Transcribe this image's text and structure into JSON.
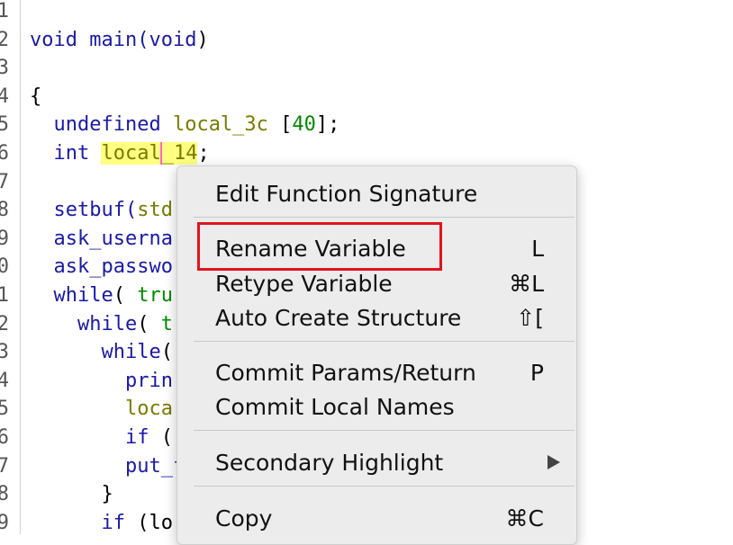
{
  "editor": {
    "lines": [
      {
        "n": "1",
        "tokens": []
      },
      {
        "n": "2",
        "tokens": [
          {
            "t": "void",
            "c": "kw"
          },
          {
            "t": " main(",
            "c": "fn"
          },
          {
            "t": "void",
            "c": "kw"
          },
          {
            "t": ")",
            "c": ""
          }
        ]
      },
      {
        "n": "3",
        "tokens": []
      },
      {
        "n": "4",
        "tokens": [
          {
            "t": "{",
            "c": ""
          }
        ]
      },
      {
        "n": "5",
        "tokens": [
          {
            "t": "  undefined ",
            "c": "kw"
          },
          {
            "t": "local_3c",
            "c": "id"
          },
          {
            "t": " [",
            "c": ""
          },
          {
            "t": "40",
            "c": "num"
          },
          {
            "t": "];",
            "c": ""
          }
        ]
      },
      {
        "n": "6",
        "tokens": [
          {
            "t": "  int ",
            "c": "kw"
          },
          {
            "t": "local",
            "c": "id hl"
          },
          {
            "t": "_14",
            "c": "id hl cursor"
          },
          {
            "t": ";",
            "c": ""
          }
        ]
      },
      {
        "n": "7",
        "tokens": []
      },
      {
        "n": "8",
        "tokens": [
          {
            "t": "  setbuf(",
            "c": "fn"
          },
          {
            "t": "std",
            "c": "id"
          }
        ]
      },
      {
        "n": "9",
        "tokens": [
          {
            "t": "  ask_userna",
            "c": "fn"
          }
        ]
      },
      {
        "n": "0",
        "tokens": [
          {
            "t": "  ask_passwo",
            "c": "fn"
          }
        ]
      },
      {
        "n": "1",
        "tokens": [
          {
            "t": "  while",
            "c": "kw"
          },
          {
            "t": "( ",
            "c": ""
          },
          {
            "t": "tru",
            "c": "num"
          }
        ]
      },
      {
        "n": "2",
        "tokens": [
          {
            "t": "    while",
            "c": "kw"
          },
          {
            "t": "( ",
            "c": ""
          },
          {
            "t": "t",
            "c": "num"
          }
        ]
      },
      {
        "n": "3",
        "tokens": [
          {
            "t": "      while",
            "c": "kw"
          },
          {
            "t": "(",
            "c": ""
          }
        ]
      },
      {
        "n": "4",
        "tokens": [
          {
            "t": "        prin",
            "c": "fn"
          }
        ]
      },
      {
        "n": "5",
        "tokens": [
          {
            "t": "        loca",
            "c": "id"
          }
        ]
      },
      {
        "n": "6",
        "tokens": [
          {
            "t": "        if ",
            "c": "kw"
          },
          {
            "t": "(",
            "c": ""
          }
        ]
      },
      {
        "n": "7",
        "tokens": [
          {
            "t": "        put_f",
            "c": "fn"
          }
        ]
      },
      {
        "n": "8",
        "tokens": [
          {
            "t": "      }",
            "c": ""
          }
        ]
      },
      {
        "n": "9",
        "tokens": [
          {
            "t": "      if ",
            "c": "kw"
          },
          {
            "t": "(lo",
            "c": ""
          }
        ]
      }
    ]
  },
  "context_menu": {
    "items": [
      {
        "label": "Edit Function Signature",
        "shortcut": ""
      },
      {
        "label": "Rename Variable",
        "shortcut": "L"
      },
      {
        "label": "Retype Variable",
        "shortcut": "⌘L"
      },
      {
        "label": "Auto Create Structure",
        "shortcut": "⇧["
      },
      {
        "label": "Commit Params/Return",
        "shortcut": "P"
      },
      {
        "label": "Commit Local Names",
        "shortcut": ""
      },
      {
        "label": "Secondary Highlight",
        "shortcut": ""
      },
      {
        "label": "Copy",
        "shortcut": "⌘C"
      }
    ],
    "submenu_arrow_icon": "chevron-right-icon"
  },
  "colors": {
    "highlight_box": "#e0141e",
    "keyword": "#1a1aa6",
    "identifier": "#7a7a00",
    "number": "#008a00"
  }
}
